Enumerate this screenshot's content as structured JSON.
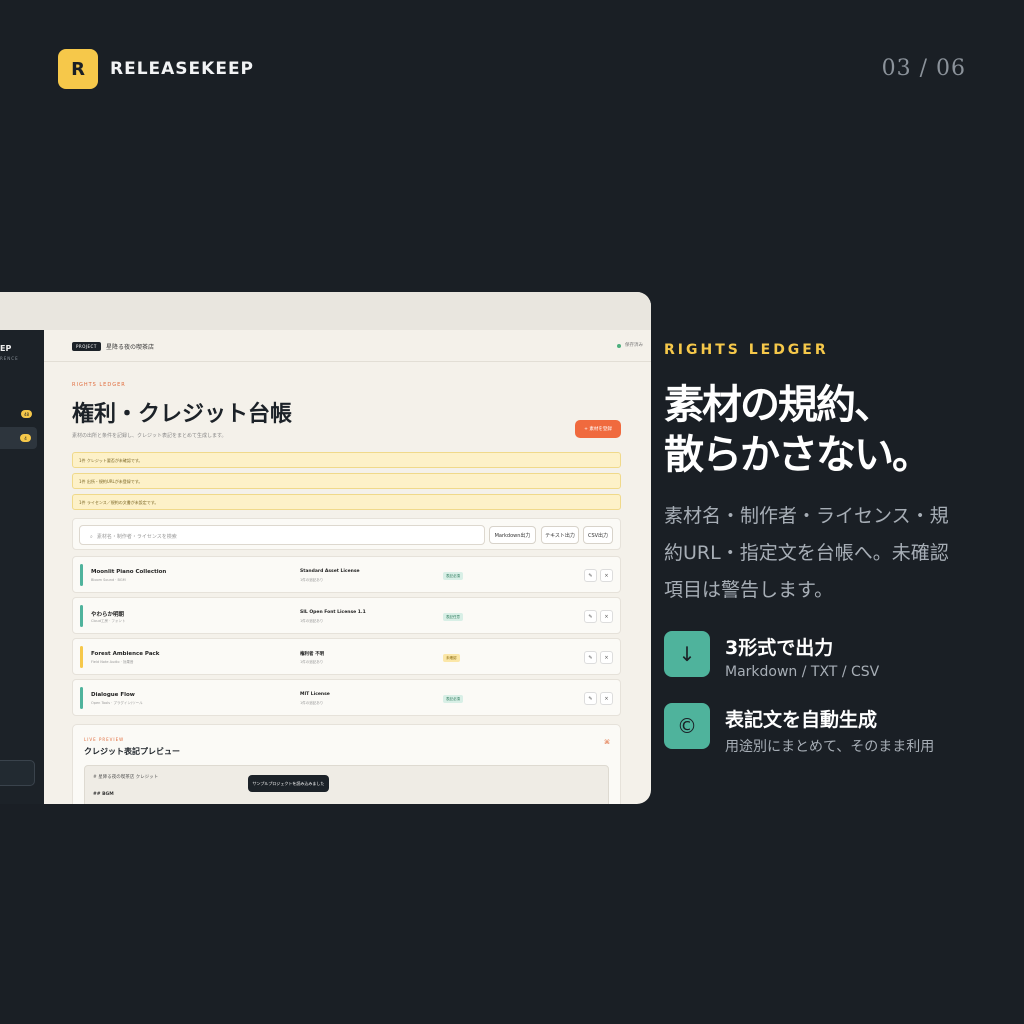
{
  "header": {
    "logo_letter": "R",
    "brand": "RELEASEKEEP",
    "page_indicator": "03 / 06"
  },
  "app": {
    "sidebar": {
      "brand_fragment": "EP",
      "brand_sub": "RENCE",
      "badges": [
        "48",
        "4"
      ]
    },
    "project_tag": "PROJECT",
    "project_name": "星降る夜の喫茶店",
    "status": "保存済み",
    "eyebrow": "RIGHTS LEDGER",
    "title": "権利・クレジット台帳",
    "subtitle": "素材の出所と条件を記録し、クレジット表記をまとめて生成します。",
    "add_button": "+ 素材を登録",
    "warnings": [
      "1件 クレジット要否が未確認です。",
      "1件 出所・規約URLが未登録です。",
      "1件 ライセンス／規約の文書が未設定です。"
    ],
    "search_placeholder": "素材名・制作者・ライセンスを検索",
    "export_buttons": [
      "Markdown出力",
      "テキスト出力",
      "CSV出力"
    ],
    "rows": [
      {
        "name": "Moonlit Piano Collection",
        "author": "Bloom Sound · BGM",
        "license": "Standard Asset License",
        "license_sub": "1件の追記あり",
        "status": "表記必須",
        "tone": "green",
        "color": "#4fb39c"
      },
      {
        "name": "やわらか明朝",
        "author": "Cloud工房 · フォント",
        "license": "SIL Open Font License 1.1",
        "license_sub": "1件の追記あり",
        "status": "表記任意",
        "tone": "green",
        "color": "#4fb39c"
      },
      {
        "name": "Forest Ambience Pack",
        "author": "Field Note Audio · 効果音",
        "license": "権利者 不明",
        "license_sub": "1件の追記あり",
        "status": "未確認",
        "tone": "yellow",
        "color": "#f6c84a"
      },
      {
        "name": "Dialogue Flow",
        "author": "Open Tools · プラグイン/ツール",
        "license": "MIT License",
        "license_sub": "1件の追記あり",
        "status": "表記必須",
        "tone": "green",
        "color": "#4fb39c"
      }
    ],
    "credit_eyebrow": "LIVE PREVIEW",
    "credit_title": "クレジット表記プレビュー",
    "credit_line1": "# 星降る夜の喫茶店 クレジット",
    "credit_line2": "## BGM",
    "toast": "サンプルプロジェクトを読み込みました"
  },
  "panel": {
    "eyebrow": "RIGHTS LEDGER",
    "title_line1": "素材の規約、",
    "title_line2": "散らかさない。",
    "description": "素材名・制作者・ライセンス・規約URL・指定文を台帳へ。未確認項目は警告します。",
    "features": [
      {
        "icon": "download-arrow-icon",
        "glyph": "↓",
        "title": "3形式で出力",
        "subtitle": "Markdown / TXT / CSV"
      },
      {
        "icon": "copyright-icon",
        "glyph": "©",
        "title": "表記文を自動生成",
        "subtitle": "用途別にまとめて、そのまま利用"
      }
    ]
  },
  "colors": {
    "background": "#1a1f25",
    "accent_yellow": "#f6c84a",
    "accent_teal": "#4fb39c",
    "accent_orange": "#f06a3e"
  }
}
